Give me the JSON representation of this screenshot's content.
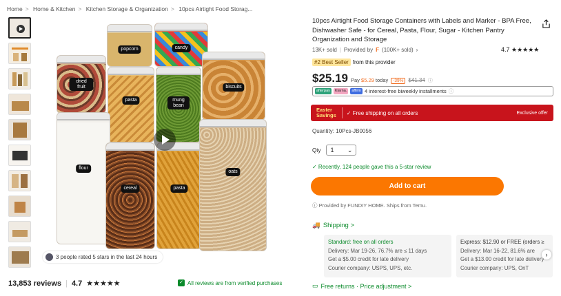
{
  "breadcrumb": [
    "Home",
    "Home & Kitchen",
    "Kitchen Storage & Organization",
    "10pcs Airtight Food Storag..."
  ],
  "gallery": {
    "rated_text": "3 people rated 5 stars in the last 24 hours",
    "labels": [
      "popcorn",
      "candy",
      "dried fruit",
      "biscuits",
      "pasta",
      "mung bean",
      "flour",
      "cereal",
      "pasta",
      "oats"
    ]
  },
  "reviews": {
    "count_text": "13,853 reviews",
    "rating": "4.7",
    "stars": "★★★★★",
    "verified_text": "All reviews are from verified purchases"
  },
  "product": {
    "title": "10pcs Airtight Food Storage Containers with Labels and Marker - BPA Free, Dishwasher Safe - for Cereal, Pasta, Flour, Sugar - Kitchen Pantry Organization and Storage",
    "sold": "13K+ sold",
    "provided_by_label": "Provided by",
    "store_glyph": "F",
    "store_orders": "(100K+ sold)",
    "rating": "4.7",
    "stars": "★★★★★",
    "best_seller_badge": "#2 Best Seller",
    "best_seller_suffix": "from this provider"
  },
  "price": {
    "current": "$25.19",
    "pay_prefix": "Pay",
    "pay_amount": "$5.29",
    "pay_suffix": "today",
    "discount": "-39%",
    "original": "$41.34"
  },
  "installments": {
    "providers": [
      "afterpay",
      "Klarna.",
      "affirm"
    ],
    "text": "4 interest-free biweekly installments"
  },
  "promo": {
    "badge_line1": "Easter",
    "badge_line2": "Savings",
    "text": "✓ Free shipping on all orders",
    "exclusive": "Exclusive offer"
  },
  "quantity_line": "Quantity: 10Pcs-JB0056",
  "qty": {
    "label": "Qty",
    "value": "1"
  },
  "recent": "✓ Recently, 124 people gave this a 5-star review",
  "add_to_cart": "Add to cart",
  "provided_line": "Provided by FUNDIY HOME. Ships from Temu.",
  "shipping": {
    "heading": "Shipping >",
    "cards": [
      {
        "title": "Standard: free on all orders",
        "delivery": "Delivery: Mar 19-26, 76.7% are ≤ 11 days",
        "credit": "Get a $5.00 credit for late delivery",
        "courier": "Courier company:  USPS,  UPS, etc."
      },
      {
        "title": "Express: $12.90 or FREE (orders ≥",
        "delivery": "Delivery: Mar 16-22, 81.6% are",
        "credit": "Get a $13.00 credit for late delivery",
        "courier": "Courier company:  UPS,  OnT"
      }
    ]
  },
  "returns": "Free returns · Price adjustment >"
}
